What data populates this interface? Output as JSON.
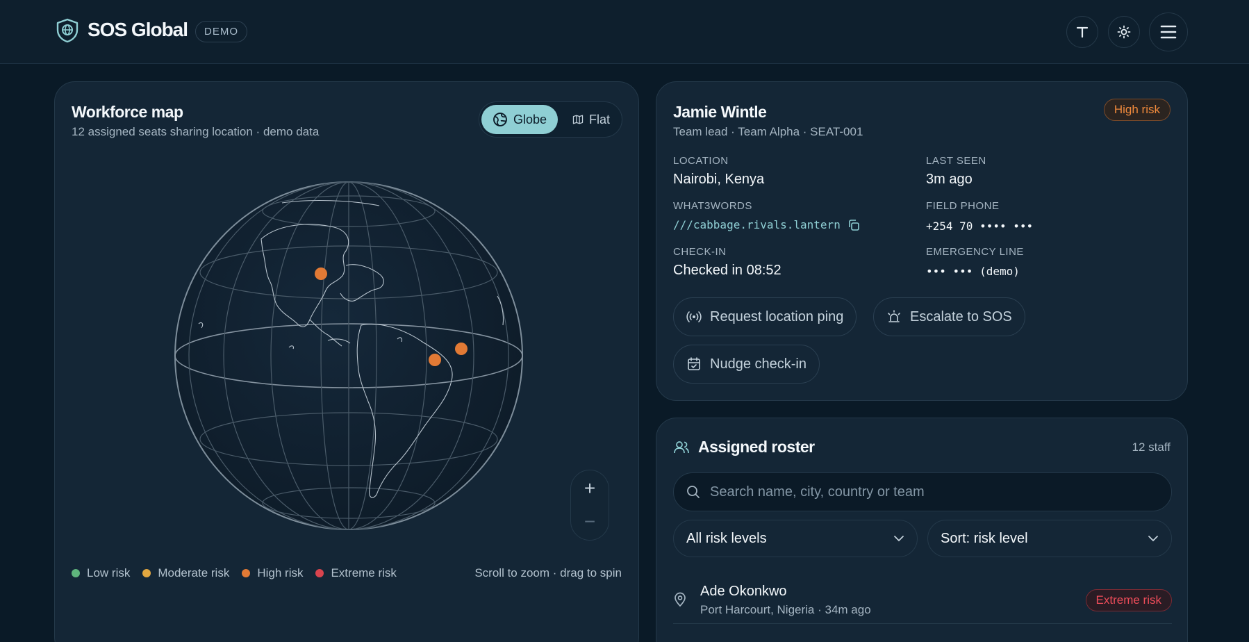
{
  "header": {
    "brand": "SOS Global",
    "badge": "DEMO",
    "buttons": [
      "text-size",
      "theme",
      "menu"
    ]
  },
  "map": {
    "title": "Workforce map",
    "subtitle": "12 assigned seats sharing location · demo data",
    "toggle": {
      "globe": "Globe",
      "flat": "Flat",
      "selected": "Globe"
    },
    "zoom_in": "+",
    "zoom_out": "−",
    "legend": [
      {
        "label": "Low risk",
        "color": "#5fb57d"
      },
      {
        "label": "Moderate risk",
        "color": "#e2a740"
      },
      {
        "label": "High risk",
        "color": "#e27a35"
      },
      {
        "label": "Extreme risk",
        "color": "#d9444e"
      }
    ],
    "hint": "Scroll to zoom · drag to spin"
  },
  "detail": {
    "name": "Jamie Wintle",
    "role": "Team lead · Team Alpha · SEAT-001",
    "risk": "High risk",
    "location_label": "LOCATION",
    "location": "Nairobi, Kenya",
    "last_seen_label": "LAST SEEN",
    "last_seen": "3m ago",
    "w3w_label": "WHAT3WORDS",
    "w3w": "///cabbage.rivals.lantern",
    "phone_label": "FIELD PHONE",
    "phone": "+254 70 •••• •••",
    "checkin_label": "CHECK-IN",
    "checkin": "Checked in 08:52",
    "emergency_label": "EMERGENCY LINE",
    "emergency": "••• ••• (demo)",
    "actions": {
      "ping": "Request location ping",
      "sos": "Escalate to SOS",
      "nudge": "Nudge check-in"
    }
  },
  "roster": {
    "title": "Assigned roster",
    "count": "12 staff",
    "search_placeholder": "Search name, city, country or team",
    "risk_filter": "All risk levels",
    "sort": "Sort: risk level",
    "rows": [
      {
        "name": "Ade Okonkwo",
        "meta": "Port Harcourt, Nigeria · 34m ago",
        "risk": "Extreme risk"
      }
    ]
  },
  "colors": {
    "accent": "#8fcfd4",
    "high": "#e27a35",
    "extreme": "#ef4d5a",
    "background": "#0a1a27"
  }
}
